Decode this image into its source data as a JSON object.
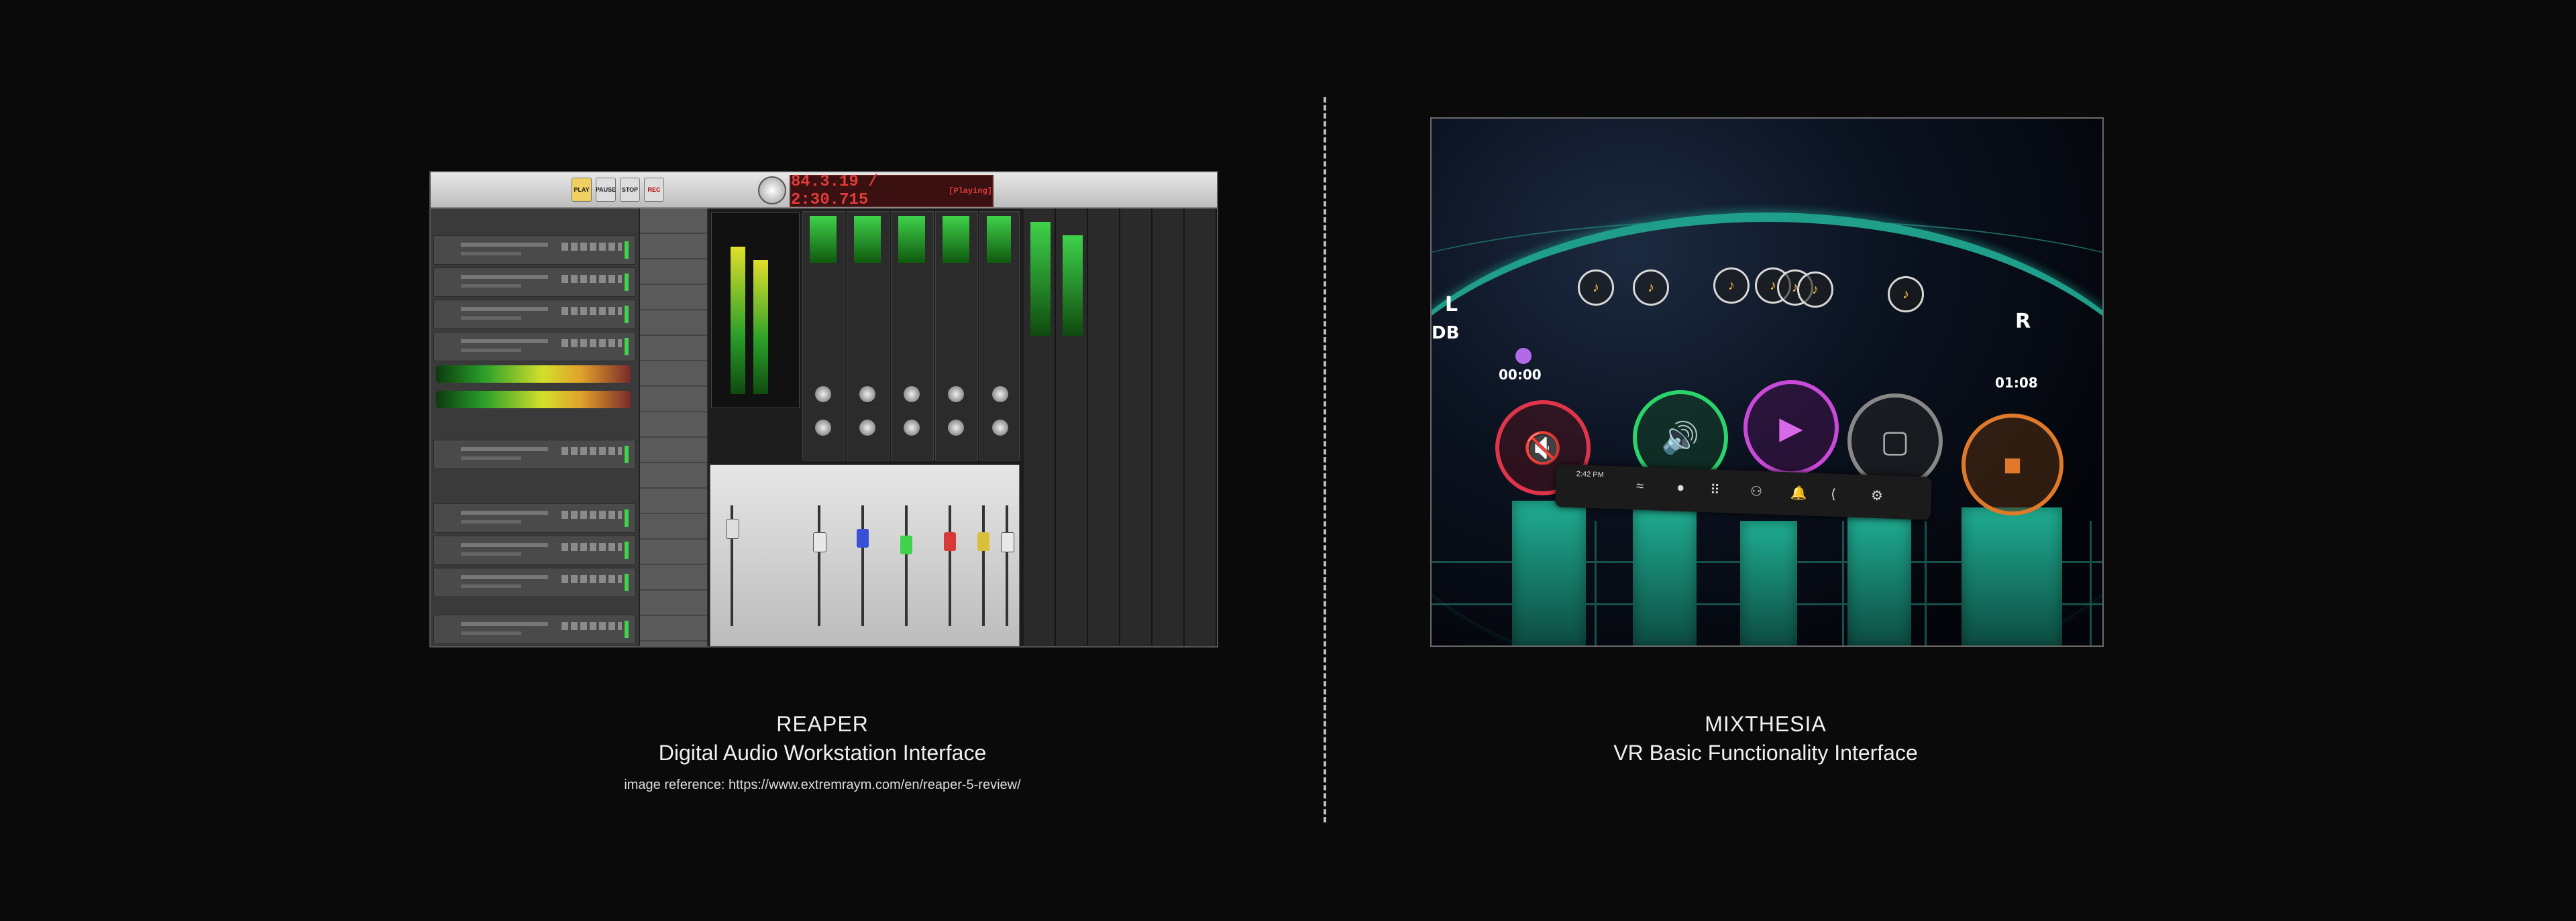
{
  "reaper": {
    "title": "REAPER",
    "subtitle": "Digital Audio Workstation Interface",
    "reference": "image reference: https://www.extremraym.com/en/reaper-5-review/",
    "time_display": "84.3.19 / 2:30.715",
    "time_status": "[Playing]",
    "transport": [
      "PLAY",
      "PAUSE",
      "STOP",
      "REC"
    ]
  },
  "mixthesia": {
    "title": "MIXTHESIA",
    "subtitle": "VR Basic Functionality Interface",
    "label_left": "L",
    "label_right": "R",
    "label_db": "DB",
    "time_start": "00:00",
    "time_end": "01:08",
    "toolbar_time": "2:42 PM",
    "buttons": [
      "mute",
      "volume",
      "play",
      "stop",
      "record"
    ]
  },
  "colors": {
    "background": "#0a0a0a",
    "vr_teal": "#1f9e8a",
    "mute_red": "#e0344a",
    "volume_green": "#2bd36a",
    "play_purple": "#c94ad8",
    "record_orange": "#e07a2a"
  }
}
